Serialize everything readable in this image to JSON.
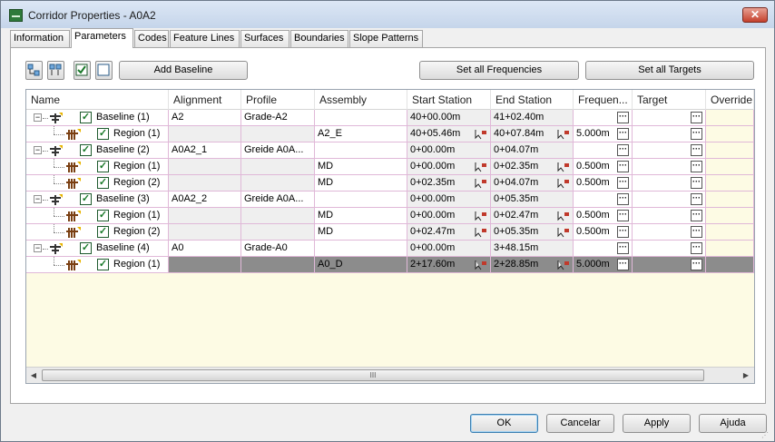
{
  "window": {
    "title": "Corridor Properties - A0A2",
    "close_label": "✕"
  },
  "tabs": [
    {
      "label": "Information"
    },
    {
      "label": "Parameters"
    },
    {
      "label": "Codes"
    },
    {
      "label": "Feature Lines"
    },
    {
      "label": "Surfaces"
    },
    {
      "label": "Boundaries"
    },
    {
      "label": "Slope Patterns"
    }
  ],
  "toolbar": {
    "add_baseline_label": "Add Baseline",
    "set_frequencies_label": "Set all Frequencies",
    "set_targets_label": "Set all Targets"
  },
  "columns": [
    {
      "label": "Name"
    },
    {
      "label": "Alignment"
    },
    {
      "label": "Profile"
    },
    {
      "label": "Assembly"
    },
    {
      "label": "Start Station"
    },
    {
      "label": "End Station"
    },
    {
      "label": "Frequen..."
    },
    {
      "label": "Target"
    },
    {
      "label": "Override"
    }
  ],
  "rows": [
    {
      "type": "baseline",
      "name": "Baseline (1)",
      "alignment": "A2",
      "profile": "Grade-A2",
      "assembly": "",
      "start": "40+00.00m",
      "end": "41+02.40m",
      "frequency": ""
    },
    {
      "type": "region",
      "name": "Region (1)",
      "alignment": "",
      "profile": "",
      "assembly": "A2_E",
      "start": "40+05.46m",
      "end": "40+07.84m",
      "frequency": "5.000m"
    },
    {
      "type": "baseline",
      "name": "Baseline (2)",
      "alignment": "A0A2_1",
      "profile": "Greide A0A...",
      "assembly": "",
      "start": "0+00.00m",
      "end": "0+04.07m",
      "frequency": ""
    },
    {
      "type": "region",
      "name": "Region (1)",
      "alignment": "",
      "profile": "",
      "assembly": "MD",
      "start": "0+00.00m",
      "end": "0+02.35m",
      "frequency": "0.500m"
    },
    {
      "type": "region",
      "name": "Region (2)",
      "alignment": "",
      "profile": "",
      "assembly": "MD",
      "start": "0+02.35m",
      "end": "0+04.07m",
      "frequency": "0.500m"
    },
    {
      "type": "baseline",
      "name": "Baseline (3)",
      "alignment": "A0A2_2",
      "profile": "Greide A0A...",
      "assembly": "",
      "start": "0+00.00m",
      "end": "0+05.35m",
      "frequency": ""
    },
    {
      "type": "region",
      "name": "Region (1)",
      "alignment": "",
      "profile": "",
      "assembly": "MD",
      "start": "0+00.00m",
      "end": "0+02.47m",
      "frequency": "0.500m"
    },
    {
      "type": "region",
      "name": "Region (2)",
      "alignment": "",
      "profile": "",
      "assembly": "MD",
      "start": "0+02.47m",
      "end": "0+05.35m",
      "frequency": "0.500m"
    },
    {
      "type": "baseline",
      "name": "Baseline (4)",
      "alignment": "A0",
      "profile": "Grade-A0",
      "assembly": "",
      "start": "0+00.00m",
      "end": "3+48.15m",
      "frequency": ""
    },
    {
      "type": "region",
      "name": "Region (1)",
      "alignment": "",
      "profile": "",
      "assembly": "A0_D",
      "start": "2+17.60m",
      "end": "2+28.85m",
      "frequency": "5.000m",
      "selected": true
    }
  ],
  "scrollbar": {
    "grip_label": "III"
  },
  "footer": {
    "ok_label": "OK",
    "cancel_label": "Cancelar",
    "apply_label": "Apply",
    "help_label": "Ajuda"
  }
}
